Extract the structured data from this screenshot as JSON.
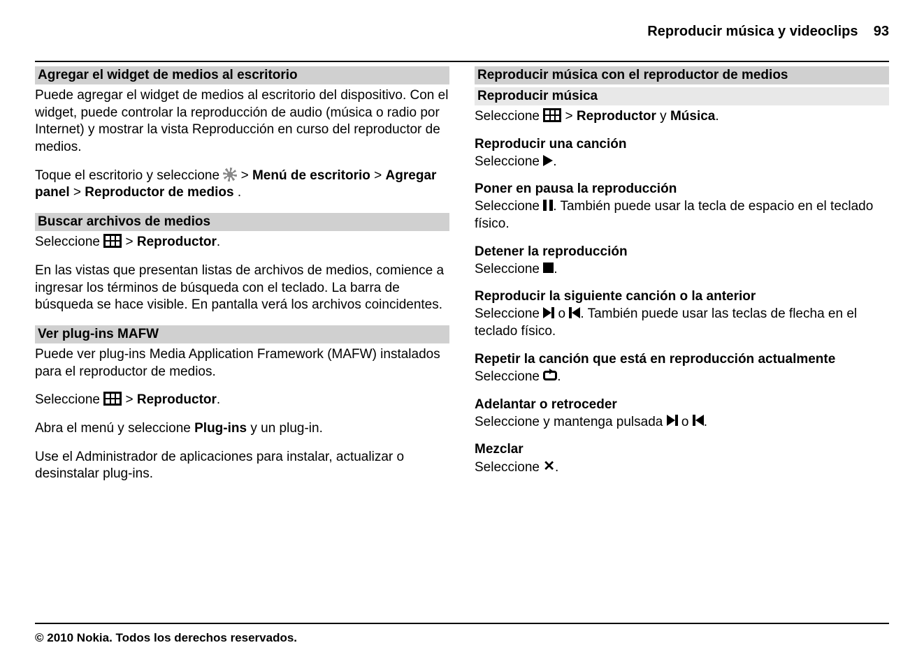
{
  "header": {
    "title": "Reproducir música y videoclips",
    "page": "93"
  },
  "left": {
    "s1": {
      "title": "Agregar el widget de medios al escritorio",
      "p1": "Puede agregar el widget de medios al escritorio del dispositivo. Con el widget, puede controlar la reproducción de audio (música o radio por Internet) y mostrar la vista Reproducción en curso del reproductor de medios.",
      "p2a": "Toque el escritorio y seleccione ",
      "p2b": " > ",
      "p2c": "Menú de escritorio",
      "p2d": " > ",
      "p2e": "Agregar panel",
      "p2f": " > ",
      "p2g": "Reproductor de medios",
      "p2h": "."
    },
    "s2": {
      "title": "Buscar archivos de medios",
      "p1a": "Seleccione ",
      "p1b": " > ",
      "p1c": "Reproductor",
      "p1d": ".",
      "p2": "En las vistas que presentan listas de archivos de medios, comience a ingresar los términos de búsqueda con el teclado. La barra de búsqueda se hace visible. En pantalla verá los archivos coincidentes."
    },
    "s3": {
      "title": "Ver plug-ins MAFW",
      "p1": "Puede ver plug-ins Media Application Framework (MAFW) instalados para el reproductor de medios.",
      "p2a": "Seleccione ",
      "p2b": " > ",
      "p2c": "Reproductor",
      "p2d": ".",
      "p3a": "Abra el menú y seleccione ",
      "p3b": "Plug-ins",
      "p3c": " y un plug-in.",
      "p4": "Use el Administrador de aplicaciones para instalar, actualizar o desinstalar plug-ins."
    }
  },
  "right": {
    "r1": {
      "title": "Reproducir música con el reproductor de medios",
      "sub": "Reproducir música",
      "p1a": "Seleccione ",
      "p1b": " > ",
      "p1c": "Reproductor",
      "p1d": " y ",
      "p1e": "Música",
      "p1f": "."
    },
    "r2": {
      "h": "Reproducir una canción",
      "a": "Seleccione ",
      "b": "."
    },
    "r3": {
      "h": "Poner en pausa la reproducción",
      "a": "Seleccione ",
      "b": ". También puede usar la tecla de espacio en el teclado físico."
    },
    "r4": {
      "h": "Detener la reproducción",
      "a": "Seleccione ",
      "b": "."
    },
    "r5": {
      "h": "Reproducir la siguiente canción o la anterior",
      "a": "Seleccione ",
      "mid": " o ",
      "b": ". También puede usar las teclas de flecha en el teclado físico."
    },
    "r6": {
      "h": "Repetir la canción que está en reproducción actualmente",
      "a": "Seleccione ",
      "b": "."
    },
    "r7": {
      "h": "Adelantar o retroceder",
      "a": "Seleccione y mantenga pulsada ",
      "mid": " o ",
      "b": "."
    },
    "r8": {
      "h": "Mezclar",
      "a": "Seleccione ",
      "b": "."
    }
  },
  "footer": "© 2010 Nokia. Todos los derechos reservados."
}
